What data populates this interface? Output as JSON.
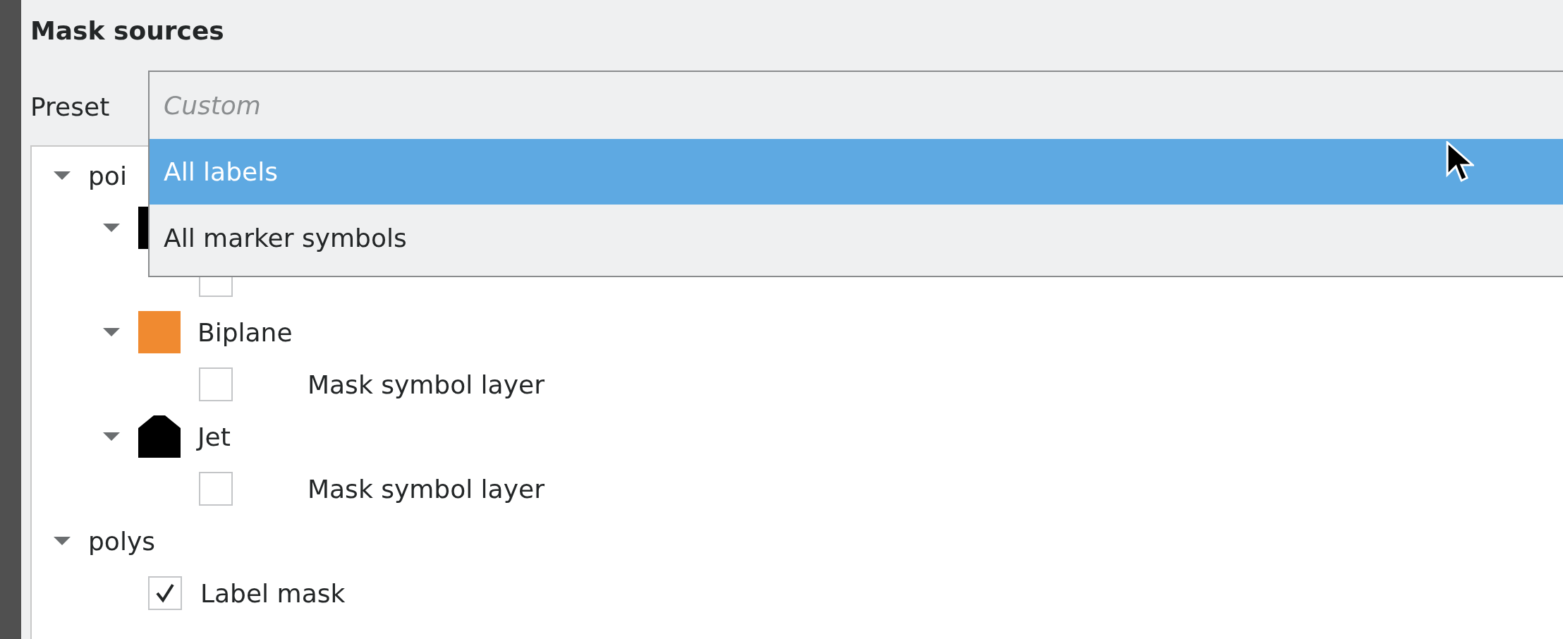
{
  "heading": "Mask sources",
  "preset": {
    "label": "Preset",
    "options": [
      {
        "label": "Custom",
        "kind": "placeholder",
        "selected": false
      },
      {
        "label": "All labels",
        "kind": "preset",
        "selected": true
      },
      {
        "label": "All marker symbols",
        "kind": "preset",
        "selected": false
      }
    ]
  },
  "tree": [
    {
      "label": "poi",
      "expanded": true,
      "children": [
        {
          "symbol": {
            "kind": "square",
            "color": "#000000"
          },
          "expanded": true,
          "children": [
            {
              "kind": "symbol-layer",
              "checked": false
            }
          ]
        },
        {
          "label": "Biplane",
          "symbol": {
            "kind": "square",
            "color": "#f08a30"
          },
          "expanded": true,
          "children": [
            {
              "kind": "symbol-layer",
              "label": "Mask symbol layer",
              "checked": false
            }
          ]
        },
        {
          "label": "Jet",
          "symbol": {
            "kind": "house",
            "color": "#000000"
          },
          "expanded": true,
          "children": [
            {
              "kind": "symbol-layer",
              "label": "Mask symbol layer",
              "checked": false
            }
          ]
        }
      ]
    },
    {
      "label": "polys",
      "expanded": true,
      "children": [
        {
          "kind": "label-mask",
          "label": "Label mask",
          "checked": true
        }
      ]
    }
  ]
}
